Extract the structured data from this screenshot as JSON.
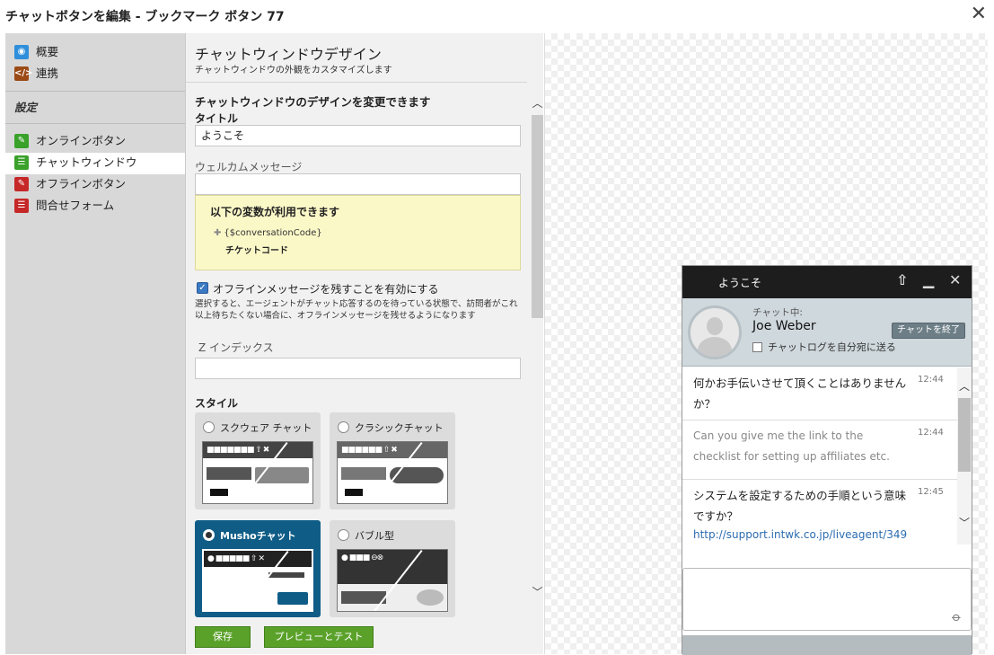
{
  "window": {
    "title": "チャットボタンを編集 - ブックマーク ボタン 77",
    "close_icon": "close-icon"
  },
  "sidebar": {
    "top_items": [
      {
        "label": "概要",
        "icon": "chat-bubble-icon",
        "color": "#2f8fdb"
      },
      {
        "label": "連携",
        "icon": "code-icon",
        "color": "#9b4a17"
      }
    ],
    "section_title": "設定",
    "items": [
      {
        "label": "オンラインボタン",
        "icon": "online-button-icon",
        "color": "#3aa12b"
      },
      {
        "label": "チャットウィンドウ",
        "icon": "chat-window-icon",
        "color": "#3aa12b",
        "active": true
      },
      {
        "label": "オフラインボタン",
        "icon": "offline-button-icon",
        "color": "#c62828"
      },
      {
        "label": "問合せフォーム",
        "icon": "contact-form-icon",
        "color": "#c62828"
      }
    ]
  },
  "form": {
    "heading": "チャットウィンドウデザイン",
    "subheading": "チャットウィンドウの外観をカスタマイズします",
    "section_title": "チャットウィンドウのデザインを変更できます",
    "title_label": "タイトル",
    "title_value": "ようこそ",
    "welcome_label": "ウェルカムメッセージ",
    "welcome_value": "",
    "variables": {
      "title": "以下の変数が利用できます",
      "code": "{$conversationCode}",
      "desc": "チケットコード"
    },
    "offline_checkbox": {
      "checked": true,
      "label": "オフラインメッセージを残すことを有効にする",
      "desc": "選択すると、エージェントがチャット応答するのを待っている状態で、訪問者がこれ以上待ちたくない場合に、オフラインメッセージを残せるようになります"
    },
    "zindex_label": "Z インデックス",
    "zindex_value": "",
    "style_label": "スタイル",
    "styles": [
      {
        "label": "スクウェア チャット",
        "selected": false
      },
      {
        "label": "クラシックチャット",
        "selected": false
      },
      {
        "label": "Mushoチャット",
        "selected": true
      },
      {
        "label": "バブル型",
        "selected": false
      }
    ],
    "save_label": "保存",
    "preview_label": "プレビューとテスト"
  },
  "widget": {
    "title": "ようこそ",
    "status": "チャット中:",
    "agent_name": "Joe Weber",
    "end_button": "チャットを終了",
    "send_log_label": "チャットログを自分宛に送る",
    "messages": [
      {
        "text": "何かお手伝いさせて頂くことはありませんか？",
        "time": "12:44",
        "type": "agent"
      },
      {
        "text": "Can you give me the link to the checklist for setting up affiliates etc.",
        "time": "12:44",
        "type": "visitor"
      },
      {
        "text": "システムを設定するための手順という意味ですか？",
        "time": "12:45",
        "type": "agent",
        "link": "http://support.intwk.co.jp/liveagent/349"
      }
    ]
  }
}
